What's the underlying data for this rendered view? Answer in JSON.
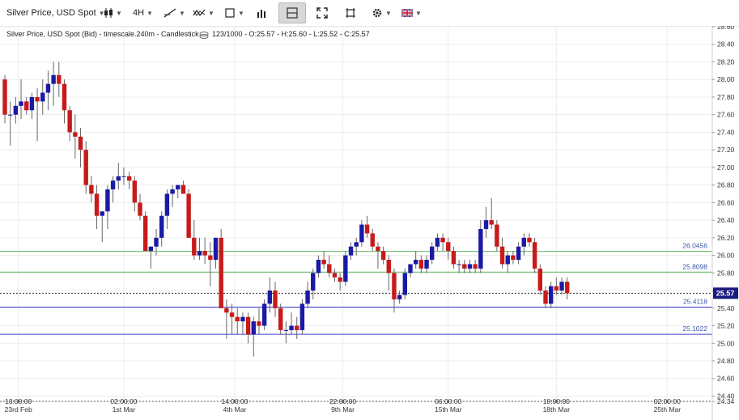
{
  "toolbar": {
    "instrument_label": "Silver Price, USD Spot",
    "timeframe_label": "4H"
  },
  "chart_info_text": "Silver Price, USD Spot (Bid) - timescale.240m - Candlestick",
  "ohlc_text": "123/1000 - O:25.57 - H:25.60 - L:25.52 - C:25.57",
  "colors": {
    "bull": "#1a1aa6",
    "bear": "#c81a1a",
    "green_line": "#5cb85c",
    "blue_line": "#3a3ad0",
    "price_tag": "#1a1a80"
  },
  "chart_data": {
    "type": "candlestick",
    "ylim": [
      24.34,
      28.6
    ],
    "y_ticks": [
      "28.60",
      "28.40",
      "28.20",
      "28.00",
      "27.80",
      "27.60",
      "27.40",
      "27.20",
      "27.00",
      "26.80",
      "26.60",
      "26.40",
      "26.20",
      "26.00",
      "25.80",
      "25.60",
      "25.40",
      "25.20",
      "25.00",
      "24.80",
      "24.60",
      "24.40",
      "24.34"
    ],
    "x_ticks": [
      {
        "i": 2.5,
        "time": "18:00:00",
        "date": "23rd Feb"
      },
      {
        "i": 22,
        "time": "02:00:00",
        "date": "1st Mar"
      },
      {
        "i": 42.5,
        "time": "14:00:00",
        "date": "4th Mar"
      },
      {
        "i": 62.5,
        "time": "22:00:00",
        "date": "9th Mar"
      },
      {
        "i": 82,
        "time": "06:00:00",
        "date": "15th Mar"
      },
      {
        "i": 102,
        "time": "18:00:00",
        "date": "18th Mar"
      },
      {
        "i": 122.5,
        "time": "02:00:00",
        "date": "25th Mar"
      }
    ],
    "horizontal_lines": [
      {
        "value": 26.0456,
        "label": "26.0456",
        "color": "green"
      },
      {
        "value": 25.8098,
        "label": "25.8098",
        "color": "green"
      },
      {
        "value": 25.4118,
        "label": "25.4118",
        "color": "blue"
      },
      {
        "value": 25.1022,
        "label": "25.1022",
        "color": "blue"
      }
    ],
    "current_price": {
      "value": 25.57,
      "label": "25.57"
    },
    "candles": [
      [
        28.0,
        28.05,
        27.5,
        27.6
      ],
      [
        27.6,
        27.75,
        27.25,
        27.6
      ],
      [
        27.6,
        27.8,
        27.5,
        27.7
      ],
      [
        27.7,
        28.0,
        27.55,
        27.75
      ],
      [
        27.75,
        27.8,
        27.6,
        27.65
      ],
      [
        27.65,
        27.85,
        27.55,
        27.8
      ],
      [
        27.8,
        27.9,
        27.3,
        27.75
      ],
      [
        27.75,
        28.0,
        27.6,
        27.85
      ],
      [
        27.85,
        28.1,
        27.65,
        27.95
      ],
      [
        27.95,
        28.2,
        27.7,
        28.05
      ],
      [
        28.05,
        28.2,
        27.8,
        27.95
      ],
      [
        27.95,
        28.0,
        27.5,
        27.65
      ],
      [
        27.65,
        27.7,
        27.3,
        27.4
      ],
      [
        27.4,
        27.6,
        27.1,
        27.35
      ],
      [
        27.35,
        27.45,
        27.0,
        27.2
      ],
      [
        27.2,
        27.3,
        26.7,
        26.8
      ],
      [
        26.8,
        26.9,
        26.6,
        26.7
      ],
      [
        26.7,
        26.8,
        26.3,
        26.45
      ],
      [
        26.45,
        26.5,
        26.15,
        26.5
      ],
      [
        26.5,
        26.8,
        26.3,
        26.75
      ],
      [
        26.75,
        26.9,
        26.6,
        26.85
      ],
      [
        26.85,
        27.05,
        26.75,
        26.9
      ],
      [
        26.9,
        27.0,
        26.8,
        26.9
      ],
      [
        26.9,
        26.95,
        26.75,
        26.85
      ],
      [
        26.85,
        26.9,
        26.5,
        26.6
      ],
      [
        26.6,
        26.7,
        26.4,
        26.45
      ],
      [
        26.45,
        26.5,
        26.1,
        26.05
      ],
      [
        26.05,
        26.1,
        25.85,
        26.1
      ],
      [
        26.1,
        26.3,
        26.0,
        26.2
      ],
      [
        26.2,
        26.5,
        26.1,
        26.45
      ],
      [
        26.45,
        26.75,
        26.3,
        26.7
      ],
      [
        26.7,
        26.8,
        26.55,
        26.75
      ],
      [
        26.75,
        26.8,
        26.65,
        26.8
      ],
      [
        26.8,
        26.85,
        26.7,
        26.7
      ],
      [
        26.7,
        26.75,
        26.2,
        26.2
      ],
      [
        26.2,
        26.4,
        25.95,
        26.0
      ],
      [
        26.0,
        26.2,
        25.95,
        26.05
      ],
      [
        26.05,
        26.2,
        25.9,
        26.0
      ],
      [
        26.0,
        26.15,
        25.65,
        25.95
      ],
      [
        25.95,
        26.2,
        25.85,
        26.2
      ],
      [
        26.2,
        26.3,
        25.6,
        25.4
      ],
      [
        25.4,
        25.5,
        25.05,
        25.35
      ],
      [
        25.35,
        25.45,
        25.1,
        25.3
      ],
      [
        25.3,
        25.4,
        25.1,
        25.25
      ],
      [
        25.25,
        25.35,
        25.1,
        25.3
      ],
      [
        25.3,
        25.35,
        25.0,
        25.1
      ],
      [
        25.1,
        25.3,
        24.85,
        25.25
      ],
      [
        25.25,
        25.4,
        25.1,
        25.2
      ],
      [
        25.2,
        25.5,
        25.15,
        25.45
      ],
      [
        25.45,
        25.75,
        25.35,
        25.6
      ],
      [
        25.6,
        25.7,
        25.3,
        25.4
      ],
      [
        25.4,
        25.45,
        25.1,
        25.15
      ],
      [
        25.15,
        25.25,
        25.0,
        25.15
      ],
      [
        25.15,
        25.35,
        25.1,
        25.2
      ],
      [
        25.2,
        25.3,
        25.05,
        25.15
      ],
      [
        25.15,
        25.5,
        25.1,
        25.45
      ],
      [
        25.45,
        25.7,
        25.4,
        25.6
      ],
      [
        25.6,
        25.85,
        25.5,
        25.8
      ],
      [
        25.8,
        26.0,
        25.75,
        25.95
      ],
      [
        25.95,
        26.05,
        25.85,
        25.9
      ],
      [
        25.9,
        26.0,
        25.75,
        25.8
      ],
      [
        25.8,
        25.85,
        25.7,
        25.75
      ],
      [
        25.75,
        25.8,
        25.6,
        25.7
      ],
      [
        25.7,
        26.05,
        25.65,
        26.0
      ],
      [
        26.0,
        26.15,
        25.95,
        26.1
      ],
      [
        26.1,
        26.2,
        26.0,
        26.15
      ],
      [
        26.15,
        26.4,
        26.1,
        26.35
      ],
      [
        26.35,
        26.45,
        26.2,
        26.25
      ],
      [
        26.25,
        26.3,
        26.05,
        26.1
      ],
      [
        26.1,
        26.15,
        25.85,
        26.05
      ],
      [
        26.05,
        26.1,
        25.9,
        25.95
      ],
      [
        25.95,
        26.0,
        25.6,
        25.8
      ],
      [
        25.8,
        25.85,
        25.35,
        25.5
      ],
      [
        25.5,
        25.6,
        25.45,
        25.55
      ],
      [
        25.55,
        25.85,
        25.5,
        25.8
      ],
      [
        25.8,
        25.9,
        25.75,
        25.9
      ],
      [
        25.9,
        26.05,
        25.85,
        25.95
      ],
      [
        25.95,
        26.0,
        25.8,
        25.85
      ],
      [
        25.85,
        26.0,
        25.8,
        25.95
      ],
      [
        25.95,
        26.15,
        25.9,
        26.1
      ],
      [
        26.1,
        26.25,
        26.05,
        26.2
      ],
      [
        26.2,
        26.25,
        26.05,
        26.15
      ],
      [
        26.15,
        26.2,
        25.95,
        26.05
      ],
      [
        26.05,
        26.1,
        25.85,
        25.9
      ],
      [
        25.9,
        25.95,
        25.8,
        25.9
      ],
      [
        25.9,
        25.95,
        25.8,
        25.85
      ],
      [
        25.85,
        25.95,
        25.8,
        25.9
      ],
      [
        25.9,
        25.95,
        25.8,
        25.85
      ],
      [
        25.85,
        26.4,
        25.8,
        26.3
      ],
      [
        26.3,
        26.55,
        26.2,
        26.4
      ],
      [
        26.4,
        26.65,
        26.3,
        26.35
      ],
      [
        26.35,
        26.4,
        26.05,
        26.1
      ],
      [
        26.1,
        26.2,
        25.85,
        25.9
      ],
      [
        25.9,
        26.05,
        25.8,
        26.0
      ],
      [
        26.0,
        26.05,
        25.9,
        25.95
      ],
      [
        25.95,
        26.15,
        25.9,
        26.1
      ],
      [
        26.1,
        26.25,
        26.0,
        26.2
      ],
      [
        26.2,
        26.25,
        26.1,
        26.15
      ],
      [
        26.15,
        26.2,
        25.8,
        25.85
      ],
      [
        25.85,
        25.9,
        25.55,
        25.6
      ],
      [
        25.6,
        25.65,
        25.4,
        25.45
      ],
      [
        25.45,
        25.7,
        25.4,
        25.65
      ],
      [
        25.65,
        25.75,
        25.55,
        25.6
      ],
      [
        25.6,
        25.75,
        25.55,
        25.7
      ],
      [
        25.7,
        25.75,
        25.5,
        25.57
      ]
    ]
  }
}
